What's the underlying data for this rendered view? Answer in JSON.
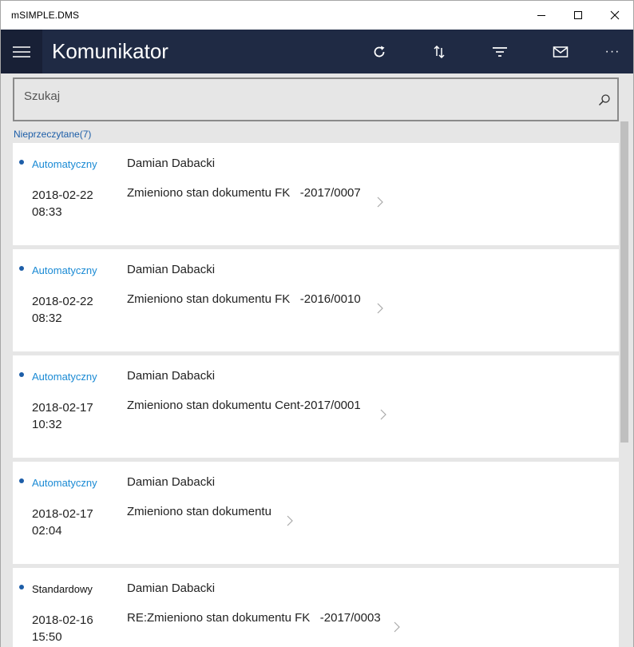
{
  "window": {
    "title": "mSIMPLE.DMS"
  },
  "appbar": {
    "title": "Komunikator",
    "commands": [
      "refresh-icon",
      "sort-icon",
      "filter-icon",
      "mail-icon",
      "more-icon"
    ],
    "more_label": "···"
  },
  "search": {
    "placeholder": "Szukaj"
  },
  "group": {
    "label": "Nieprzeczytane(7)"
  },
  "colors": {
    "appbar": "#1f2a44",
    "accent": "#1d5ea8",
    "type_link": "#1a8ad4"
  },
  "messages": [
    {
      "type": "Automatyczny",
      "sender": "Damian Dabacki",
      "date": "2018-02-22",
      "time": "08:33",
      "subject": "Zmieniono stan dokumentu FK   -2017/0007",
      "unread": true
    },
    {
      "type": "Automatyczny",
      "sender": "Damian Dabacki",
      "date": "2018-02-22",
      "time": "08:32",
      "subject": "Zmieniono stan dokumentu FK   -2016/0010",
      "unread": true
    },
    {
      "type": "Automatyczny",
      "sender": "Damian Dabacki",
      "date": "2018-02-17",
      "time": "10:32",
      "subject": "Zmieniono stan dokumentu Cent-2017/0001",
      "unread": true
    },
    {
      "type": "Automatyczny",
      "sender": "Damian Dabacki",
      "date": "2018-02-17",
      "time": "02:04",
      "subject": "Zmieniono stan dokumentu",
      "unread": true
    },
    {
      "type": "Standardowy",
      "sender": "Damian Dabacki",
      "date": "2018-02-16",
      "time": "15:50",
      "subject": "RE:Zmieniono stan dokumentu FK   -2017/0003",
      "unread": true
    }
  ]
}
